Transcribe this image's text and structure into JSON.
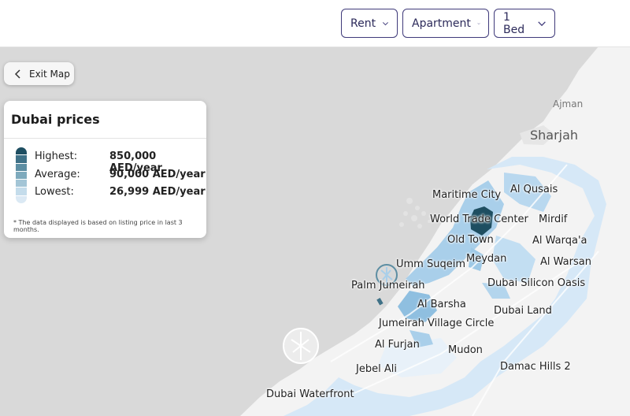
{
  "filters": [
    {
      "label": "Rent"
    },
    {
      "label": "Apartment"
    },
    {
      "label": "1 Bed"
    }
  ],
  "exit_map": {
    "label": "Exit Map"
  },
  "legend": {
    "title": "Dubai prices",
    "rows": [
      {
        "label": "Highest:",
        "value": "850,000 AED/year"
      },
      {
        "label": "Average:",
        "value": "90,000 AED/year"
      },
      {
        "label": "Lowest:",
        "value": "26,999 AED/year"
      }
    ],
    "note": "* The data displayed is based on listing price in last 3 months.",
    "scale_colors": [
      "#1e4e61",
      "#3f7187",
      "#5d8ea3",
      "#7eaabd",
      "#a3c5d6",
      "#c4dceb",
      "#dbe9f4"
    ]
  },
  "colors": {
    "land": "#f5f5f5",
    "sea": "#d9d9d9",
    "highest": "#1e4e61",
    "low": "#d6e8f7",
    "mid": "#a9cfea",
    "accent_border": "#3f3a7a"
  },
  "map_labels": {
    "ajman": "Ajman",
    "sharjah": "Sharjah",
    "maritime_city": "Maritime City",
    "al_qusais": "Al Qusais",
    "world_trade_center": "World Trade Center",
    "mirdif": "Mirdif",
    "old_town": "Old Town",
    "al_warqaa": "Al Warqa'a",
    "umm_suqeim": "Umm Suqeim",
    "meydan": "Meydan",
    "al_warsan": "Al Warsan",
    "palm_jumeirah": "Palm Jumeirah",
    "dubai_silicon_oasis": "Dubai Silicon Oasis",
    "al_barsha": "Al Barsha",
    "dubai_land": "Dubai Land",
    "jvc": "Jumeirah Village Circle",
    "al_furjan": "Al Furjan",
    "mudon": "Mudon",
    "jebel_ali": "Jebel Ali",
    "damac_hills_2": "Damac Hills 2",
    "dubai_waterfront": "Dubai Waterfront"
  }
}
